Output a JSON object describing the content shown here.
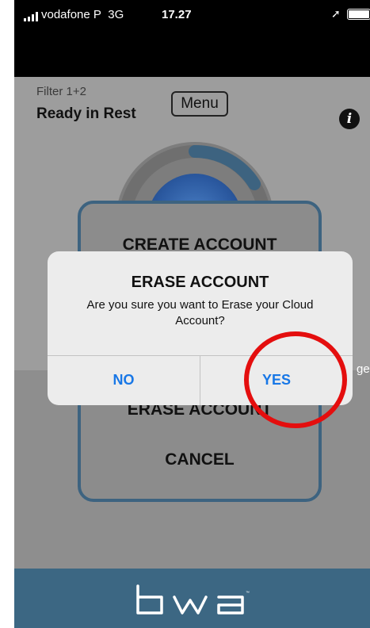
{
  "status_bar": {
    "carrier": "vodafone P",
    "network": "3G",
    "time": "17.27"
  },
  "header": {
    "filter_label": "Filter 1+2",
    "filter_status": "Ready in Rest",
    "menu_label": "Menu",
    "info_icon": "info-icon"
  },
  "background": {
    "partial_right_text": "ge"
  },
  "action_sheet": {
    "create_account": "CREATE ACCOUNT",
    "erase_account": "ERASE ACCOUNT",
    "cancel": "CANCEL"
  },
  "alert": {
    "title": "ERASE ACCOUNT",
    "message": "Are you sure you want to Erase your Cloud Account?",
    "no_label": "NO",
    "yes_label": "YES"
  },
  "footer": {
    "logo": "bwa"
  },
  "colors": {
    "accent_blue": "#1877e6",
    "footer_bg": "#3c6783",
    "annotation_red": "#e40e0e"
  }
}
